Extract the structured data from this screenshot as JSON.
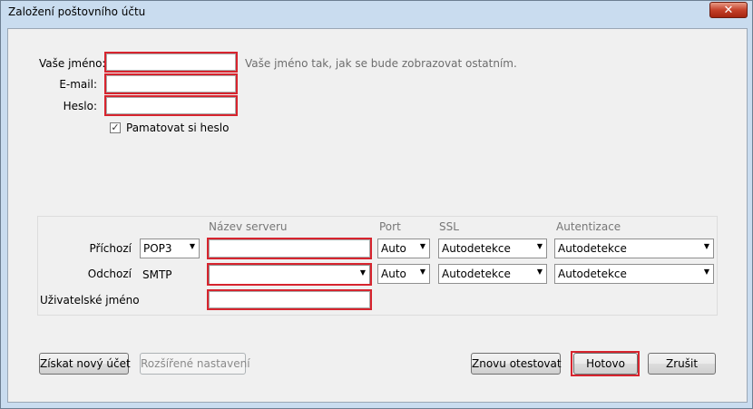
{
  "window": {
    "title": "Založení poštovního účtu",
    "close_glyph": "✕"
  },
  "form": {
    "name_label": "Vaše jméno:",
    "name_value": "",
    "name_hint": "Vaše jméno tak, jak se bude zobrazovat ostatním.",
    "email_label": "E-mail:",
    "email_value": "",
    "password_label": "Heslo:",
    "password_value": "",
    "remember_label": "Pamatovat si heslo",
    "remember_checked": true,
    "check_glyph": "✓"
  },
  "server": {
    "columns": {
      "server": "Název serveru",
      "port": "Port",
      "ssl": "SSL",
      "auth": "Autentizace"
    },
    "incoming": {
      "label": "Příchozí",
      "protocol": "POP3",
      "server": "",
      "port": "Auto",
      "ssl": "Autodetekce",
      "auth": "Autodetekce"
    },
    "outgoing": {
      "label": "Odchozí",
      "protocol": "SMTP",
      "server": "",
      "port": "Auto",
      "ssl": "Autodetekce",
      "auth": "Autodetekce"
    },
    "username": {
      "label": "Uživatelské jméno",
      "value": ""
    }
  },
  "buttons": {
    "new_account": "Získat nový účet",
    "advanced": "Rozšířené nastavení",
    "retest": "Znovu otestovat",
    "done": "Hotovo",
    "cancel": "Zrušit"
  },
  "icons": {
    "dropdown_arrow": "▼"
  },
  "colors": {
    "highlight": "#d7242e"
  }
}
